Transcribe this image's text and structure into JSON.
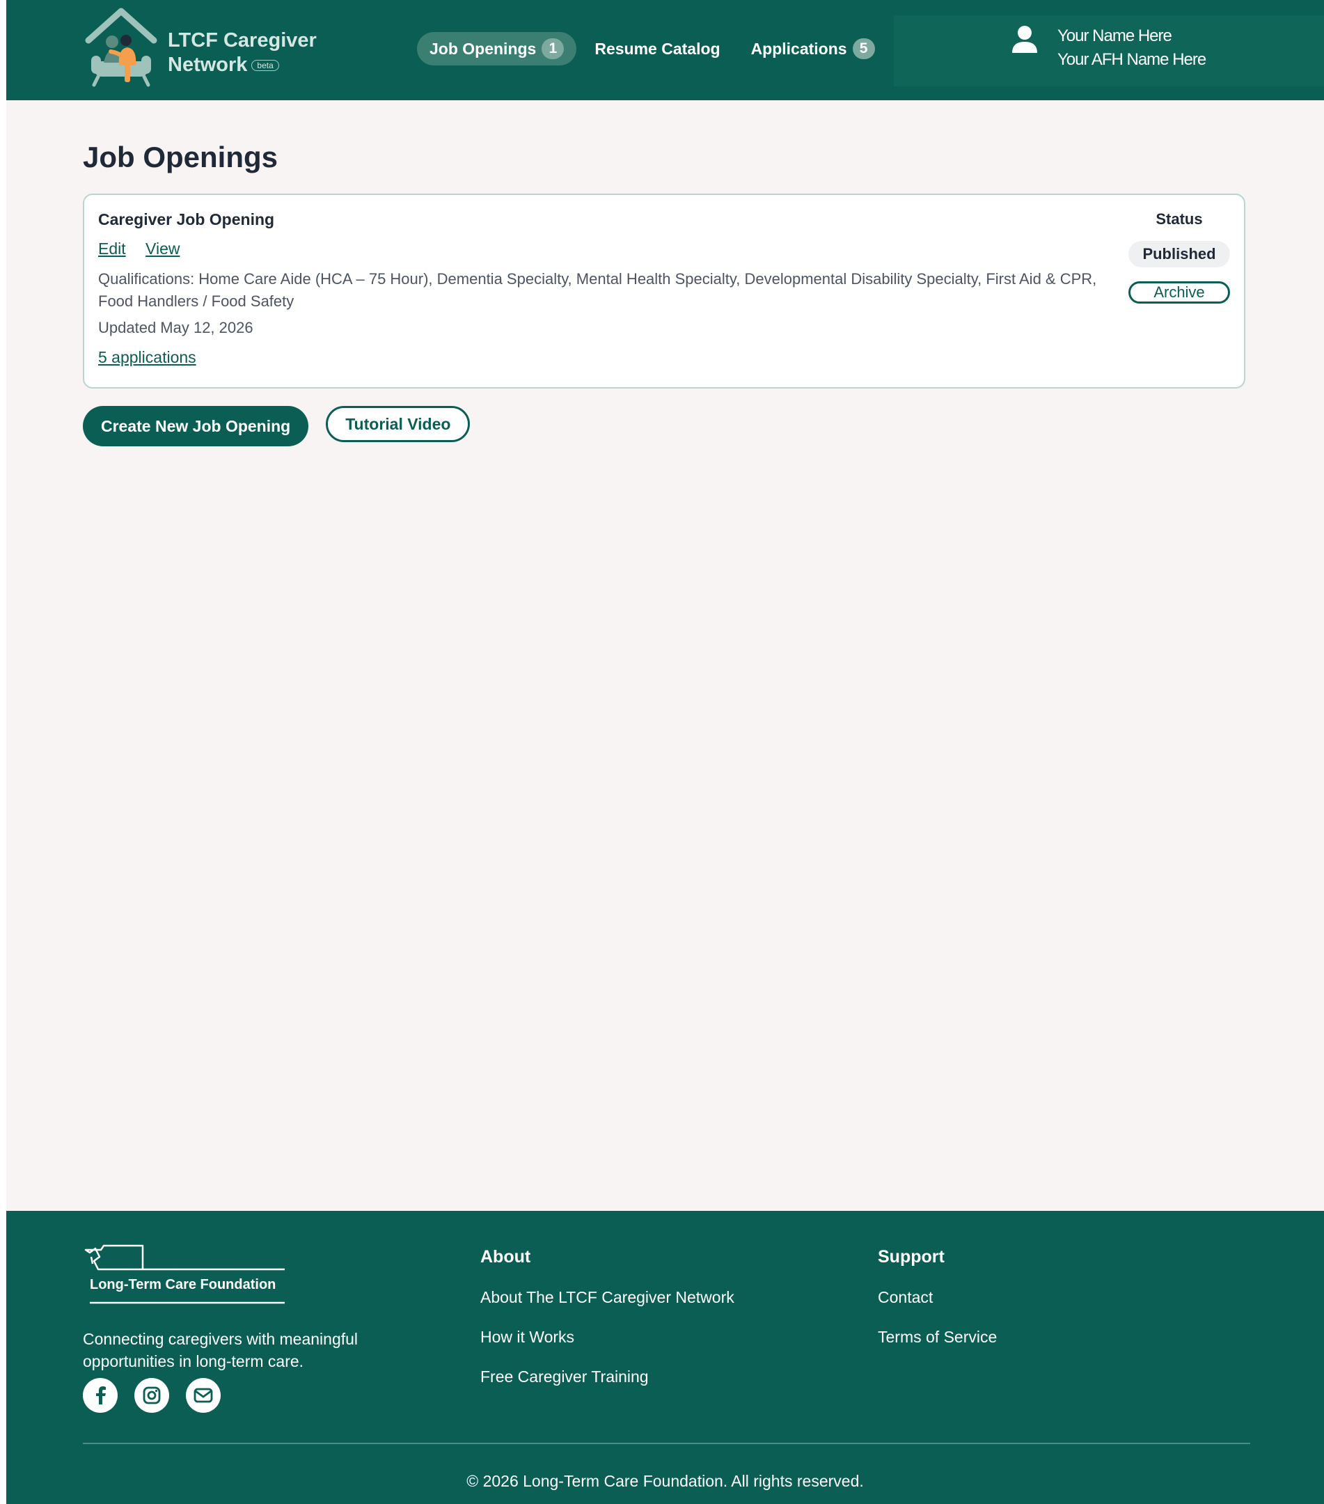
{
  "brand": {
    "line1": "LTCF Caregiver",
    "line2": "Network",
    "beta": "beta"
  },
  "nav": {
    "job_openings": "Job Openings",
    "job_openings_count": "1",
    "resume_catalog": "Resume Catalog",
    "applications": "Applications",
    "applications_count": "5"
  },
  "user": {
    "name": "Your Name Here",
    "org": "Your AFH Name Here"
  },
  "main": {
    "title": "Job Openings",
    "card": {
      "title": "Caregiver Job Opening",
      "edit": "Edit",
      "view": "View",
      "qualifications": "Qualifications: Home Care Aide (HCA – 75 Hour), Dementia Specialty, Mental Health Specialty, Developmental Disability Specialty, First Aid & CPR, Food Handlers / Food Safety",
      "updated": "Updated May 12, 2026",
      "applications": "5 applications",
      "status_label": "Status",
      "status": "Published",
      "archive": "Archive"
    },
    "create_button": "Create New Job Opening",
    "tutorial_button": "Tutorial Video"
  },
  "footer": {
    "logo_text": "Long-Term Care Foundation",
    "tagline": "Connecting caregivers with meaningful opportunities in long-term care.",
    "about_heading": "About",
    "about_links": [
      "About The LTCF Caregiver Network",
      "How it Works",
      "Free Caregiver Training"
    ],
    "support_heading": "Support",
    "support_links": [
      "Contact",
      "Terms of Service"
    ],
    "copyright": "© 2026 Long-Term Care Foundation. All rights reserved."
  },
  "colors": {
    "brand_green": "#0b5e53",
    "page_bg": "#f7f4f3",
    "accent_orange": "#f59e4c"
  },
  "icons": [
    "house-logo-icon",
    "user-icon",
    "facebook-icon",
    "instagram-icon",
    "email-icon",
    "washington-state-icon"
  ]
}
